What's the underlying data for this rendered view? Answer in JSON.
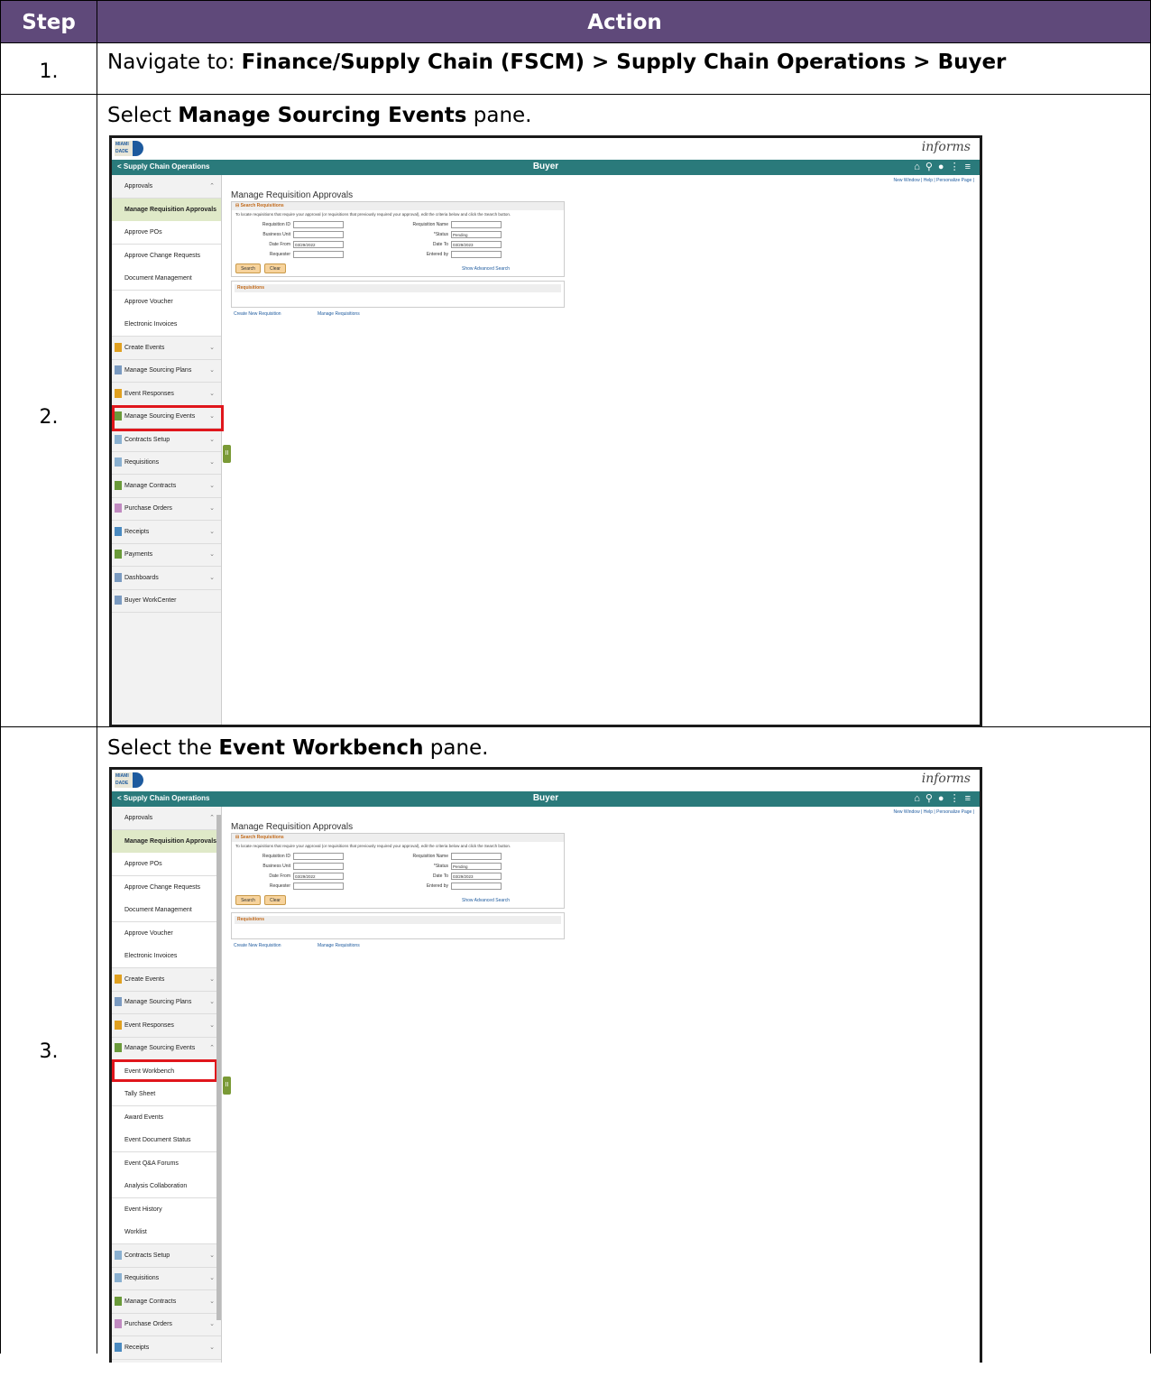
{
  "table": {
    "header_step": "Step",
    "header_action": "Action"
  },
  "steps": [
    {
      "num": "1.",
      "prefix": "Navigate to: ",
      "bold": "Finance/Supply Chain (FSCM) > Supply Chain Operations > Buyer",
      "suffix": ""
    },
    {
      "num": "2.",
      "prefix": "Select ",
      "bold": "Manage Sourcing Events",
      "suffix": " pane."
    },
    {
      "num": "3.",
      "prefix": "Select the ",
      "bold": "Event Workbench",
      "suffix": " pane."
    }
  ],
  "app": {
    "logo_text": "MIAMI DADE",
    "brand": "informs",
    "back_label": "< Supply Chain Operations",
    "title": "Buyer",
    "icons": [
      "home-icon",
      "search-icon",
      "notification-icon",
      "more-icon",
      "menu-icon"
    ],
    "links": "New Window | Help | Personalize Page |",
    "page_title": "Manage Requisition Approvals",
    "search_section": "Search Requisitions",
    "instructions": "To locate requisitions that require your approval (or requisitions that previously required your approval), edit the criteria below and click the Search button.",
    "fields": {
      "requisition_id": "Requisition ID",
      "requisition_name": "Requisition Name",
      "business_unit": "Business Unit",
      "status": "*Status",
      "status_value": "Pending",
      "date_from": "Date From",
      "date_from_value": "03/29/2022",
      "date_to": "Date To",
      "date_to_value": "03/29/2023",
      "requester": "Requester",
      "entered_by": "Entered by"
    },
    "search_button": "Search",
    "clear_button": "Clear",
    "advanced_link": "Show Advanced Search",
    "requisitions_section": "Requisitions",
    "create_link": "Create New Requisition",
    "manage_link": "Manage Requisitions",
    "handle_label": "II"
  },
  "sidebar_a": [
    {
      "label": "Approvals",
      "type": "top",
      "chev": "^"
    },
    {
      "label": "Manage Requisition Approvals",
      "type": "hl"
    },
    {
      "label": "Approve POs",
      "type": "sub"
    },
    {
      "label": "Approve Change Requests",
      "type": "sub"
    },
    {
      "label": "Document Management",
      "type": "sub"
    },
    {
      "label": "Approve Voucher",
      "type": "sub"
    },
    {
      "label": "Electronic Invoices",
      "type": "sub"
    },
    {
      "label": "Create Events",
      "type": "top",
      "chev": "v",
      "color": "#e0a020"
    },
    {
      "label": "Manage Sourcing Plans",
      "type": "top",
      "chev": "v",
      "color": "#7a9ac0"
    },
    {
      "label": "Event Responses",
      "type": "top",
      "chev": "v",
      "color": "#e0a020"
    },
    {
      "label": "Manage Sourcing Events",
      "type": "top",
      "chev": "v",
      "color": "#6a9a3a"
    },
    {
      "label": "Contracts Setup",
      "type": "top",
      "chev": "v",
      "color": "#8ab0d0"
    },
    {
      "label": "Requisitions",
      "type": "top",
      "chev": "v",
      "color": "#8ab0d0"
    },
    {
      "label": "Manage Contracts",
      "type": "top",
      "chev": "v",
      "color": "#6a9a3a"
    },
    {
      "label": "Purchase Orders",
      "type": "top",
      "chev": "v",
      "color": "#c08ac0"
    },
    {
      "label": "Receipts",
      "type": "top",
      "chev": "v",
      "color": "#4a8ac0"
    },
    {
      "label": "Payments",
      "type": "top",
      "chev": "v",
      "color": "#6a9a3a"
    },
    {
      "label": "Dashboards",
      "type": "top",
      "chev": "v",
      "color": "#7a9ac0"
    },
    {
      "label": "Buyer WorkCenter",
      "type": "top",
      "chev": "",
      "color": "#7a9ac0"
    }
  ],
  "sidebar_b": [
    {
      "label": "Approvals",
      "type": "top",
      "chev": "^"
    },
    {
      "label": "Manage Requisition Approvals",
      "type": "hl"
    },
    {
      "label": "Approve POs",
      "type": "sub"
    },
    {
      "label": "Approve Change Requests",
      "type": "sub"
    },
    {
      "label": "Document Management",
      "type": "sub"
    },
    {
      "label": "Approve Voucher",
      "type": "sub"
    },
    {
      "label": "Electronic Invoices",
      "type": "sub"
    },
    {
      "label": "Create Events",
      "type": "top",
      "chev": "v",
      "color": "#e0a020"
    },
    {
      "label": "Manage Sourcing Plans",
      "type": "top",
      "chev": "v",
      "color": "#7a9ac0"
    },
    {
      "label": "Event Responses",
      "type": "top",
      "chev": "v",
      "color": "#e0a020"
    },
    {
      "label": "Manage Sourcing Events",
      "type": "top",
      "chev": "^",
      "color": "#6a9a3a"
    },
    {
      "label": "Event Workbench",
      "type": "sub"
    },
    {
      "label": "Tally Sheet",
      "type": "sub"
    },
    {
      "label": "Award Events",
      "type": "sub"
    },
    {
      "label": "Event Document Status",
      "type": "sub"
    },
    {
      "label": "Event Q&A Forums",
      "type": "sub"
    },
    {
      "label": "Analysis Collaboration",
      "type": "sub"
    },
    {
      "label": "Event History",
      "type": "sub"
    },
    {
      "label": "Worklist",
      "type": "sub"
    },
    {
      "label": "Contracts Setup",
      "type": "top",
      "chev": "v",
      "color": "#8ab0d0"
    },
    {
      "label": "Requisitions",
      "type": "top",
      "chev": "v",
      "color": "#8ab0d0"
    },
    {
      "label": "Manage Contracts",
      "type": "top",
      "chev": "v",
      "color": "#6a9a3a"
    },
    {
      "label": "Purchase Orders",
      "type": "top",
      "chev": "v",
      "color": "#c08ac0"
    },
    {
      "label": "Receipts",
      "type": "top",
      "chev": "v",
      "color": "#4a8ac0"
    }
  ]
}
